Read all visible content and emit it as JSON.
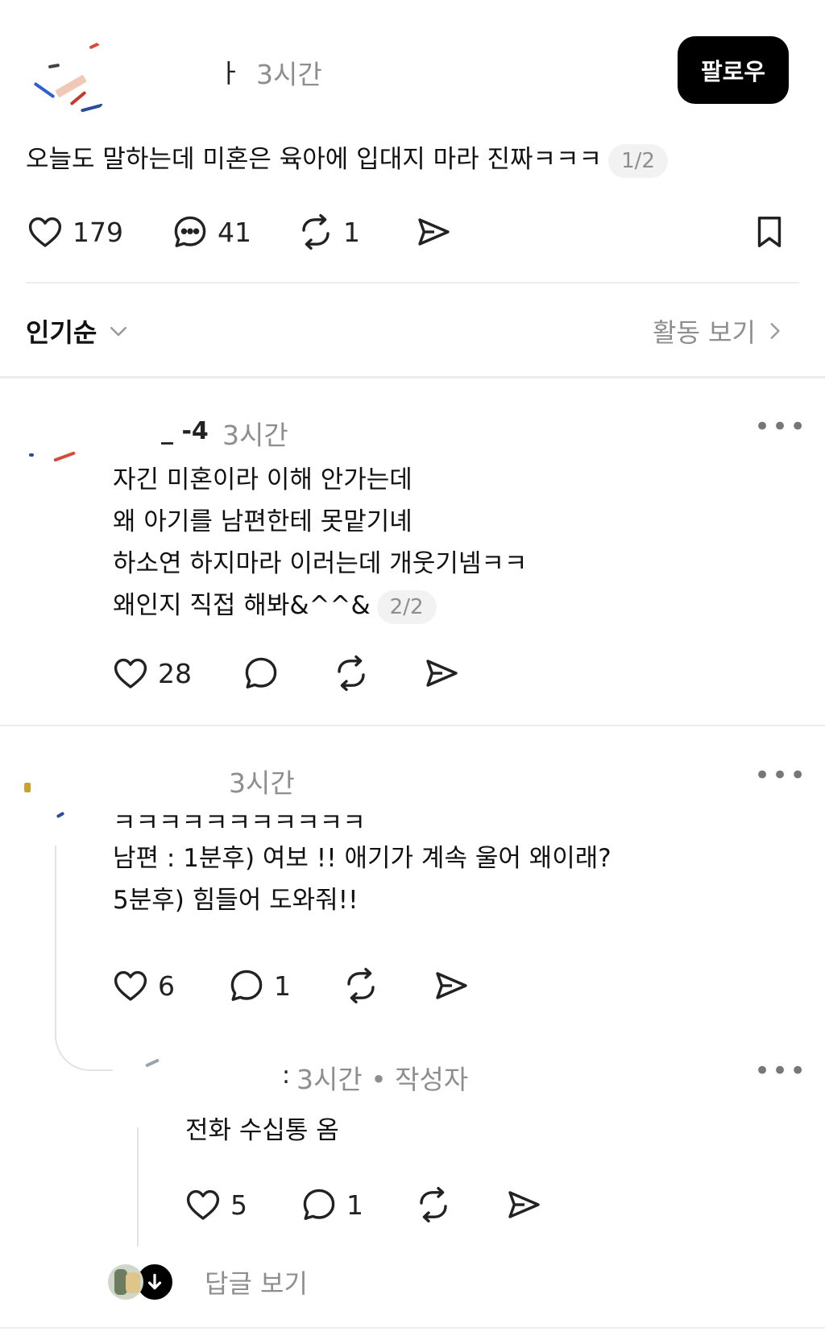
{
  "post": {
    "author_fragment": "ㅏ",
    "time": "3시간",
    "follow_label": "팔로우",
    "text": "오늘도 말하는데 미혼은 육아에 입대지 마라 진짜ㅋㅋㅋ",
    "page_indicator": "1/2",
    "likes": "179",
    "comments": "41",
    "reposts": "1"
  },
  "sort": {
    "label": "인기순",
    "activity_label": "활동 보기"
  },
  "replies": [
    {
      "author_fragment": "_ -4",
      "time": "3시간",
      "lines": [
        "자긴 미혼이라 이해 안가는데",
        "왜 아기를 남편한테 못맡기녜",
        "하소연 하지마라 이러는데 개웃기넴ㅋㅋ",
        "왜인지 직접 해봐&^^&"
      ],
      "page_indicator": "2/2",
      "likes": "28"
    },
    {
      "author_fragment": "",
      "time": "3시간",
      "lines": [
        "ㅋㅋㅋㅋㅋㅋㅋㅋㅋㅋㅋ",
        "남편 : 1분후) 여보 !! 애기가 계속 울어 왜이래?",
        "5분후) 힘들어 도와줘!!"
      ],
      "likes": "6",
      "comments": "1"
    },
    {
      "author_fragment": ":",
      "time": "3시간 • 작성자",
      "lines": [
        "전화 수십통 옴"
      ],
      "likes": "5",
      "comments": "1"
    }
  ],
  "view_replies_label": "답글 보기",
  "icons": [
    "heart-icon",
    "comment-icon",
    "repost-icon",
    "share-icon",
    "bookmark-icon",
    "chevron-down-icon",
    "chevron-right-icon",
    "more-icon",
    "arrow-down-icon"
  ]
}
